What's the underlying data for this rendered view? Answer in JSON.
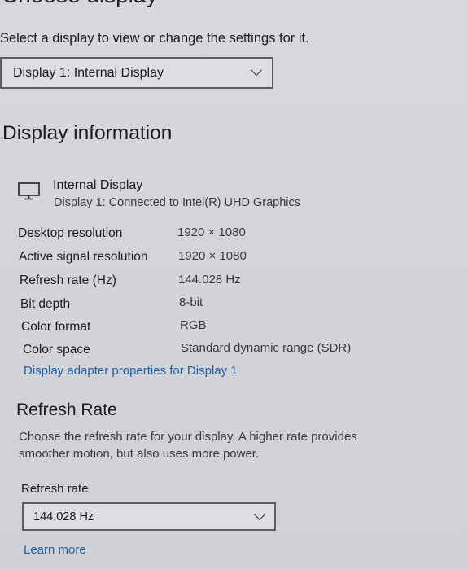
{
  "header": {
    "title": "Choose display",
    "subtitle": "Select a display to view or change the settings for it."
  },
  "display_select": {
    "selected": "Display 1: Internal Display"
  },
  "display_info": {
    "heading": "Display information",
    "monitor_icon": "monitor-icon",
    "display_name": "Internal Display",
    "connection": "Display 1: Connected to Intel(R) UHD Graphics",
    "rows": [
      {
        "label": "Desktop resolution",
        "value": "1920 × 1080"
      },
      {
        "label": "Active signal resolution",
        "value": "1920 × 1080"
      },
      {
        "label": "Refresh rate (Hz)",
        "value": "144.028 Hz"
      },
      {
        "label": "Bit depth",
        "value": "8-bit"
      },
      {
        "label": "Color format",
        "value": "RGB"
      },
      {
        "label": "Color space",
        "value": "Standard dynamic range (SDR)"
      }
    ],
    "adapter_link": "Display adapter properties for Display 1"
  },
  "refresh_rate": {
    "heading": "Refresh Rate",
    "description": "Choose the refresh rate for your display. A higher rate provides smoother motion, but also uses more power.",
    "label": "Refresh rate",
    "selected": "144.028 Hz",
    "learn_more": "Learn more"
  },
  "colors": {
    "background": "#d3d5da",
    "link": "#1d5faa",
    "dropdown_border": "#5c5e62"
  }
}
